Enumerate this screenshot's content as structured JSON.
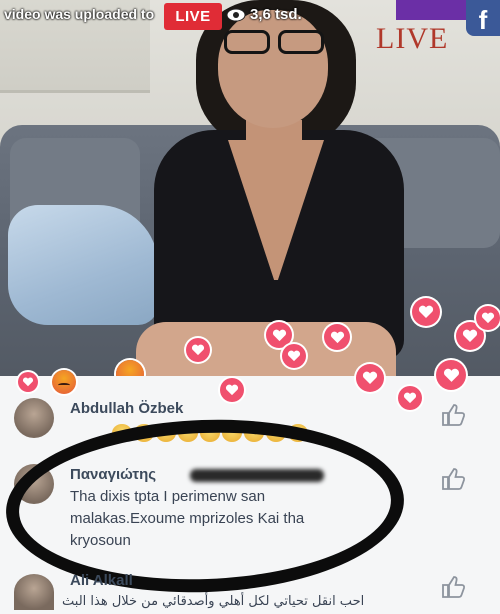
{
  "video": {
    "overlay_text": "video was uploaded to",
    "live_badge": "LIVE",
    "viewer_count": "3,6 tsd.",
    "watermark": "LIVE",
    "platform_logo": "f"
  },
  "reactions": {
    "heart_icon": "heart-icon",
    "angry_icon": "angry-face-icon",
    "heart_color": "#f0506e"
  },
  "comments": [
    {
      "author": "Abdullah Özbek",
      "text": "",
      "has_emoji_row": true
    },
    {
      "author": "Παναγιώτης",
      "text_lines": [
        "Tha dixis tpta I perimenw san",
        "malakas.Exoume mprizoles Kai tha",
        "kryosoun"
      ]
    },
    {
      "author": "Ali Alkall",
      "text": "احب انقل تحياتي لكل أهلي وأصدقائي من خلال هذا البث"
    }
  ],
  "colors": {
    "live_red": "#e02c36",
    "facebook_blue": "#3b5998",
    "author_text": "#3c4a5c"
  }
}
